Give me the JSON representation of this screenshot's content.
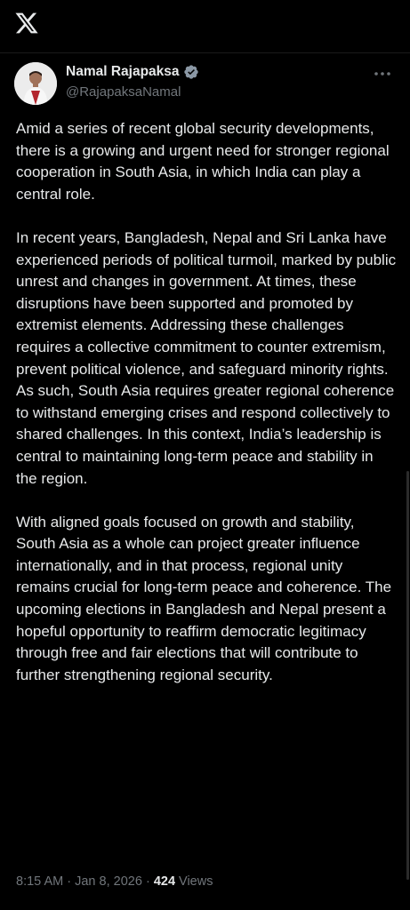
{
  "app": {
    "logo_icon": "x-logo-icon"
  },
  "author": {
    "display_name": "Namal Rajapaksa",
    "handle": "@RajapaksaNamal",
    "verified": true,
    "verified_badge_color": "#8b98a5",
    "more_icon": "more-horizontal-icon"
  },
  "tweet": {
    "paragraphs": [
      "Amid a series of recent global security developments, there is a growing and urgent need for stronger regional cooperation in South Asia, in which India can play a central role.",
      "In recent years, Bangladesh, Nepal and Sri Lanka have experienced periods of political turmoil, marked by public unrest and changes in government. At times, these disruptions have been supported and promoted by extremist elements. Addressing these challenges requires a collective commitment to counter extremism, prevent political violence, and safeguard minority rights. As such, South Asia requires greater regional coherence to withstand emerging crises and respond collectively to shared challenges. In this context, India’s leadership is central to maintaining long-term peace and stability in the region.",
      "With aligned goals focused on growth and stability, South Asia as a whole can project greater influence internationally, and in that process, regional unity remains crucial for long-term peace and coherence. The upcoming elections in Bangladesh and Nepal present a hopeful opportunity to reaffirm democratic legitimacy through free and fair elections that will contribute to further strengthening regional security."
    ],
    "time": "8:15 AM",
    "separator": "·",
    "date": "Jan 8, 2026",
    "views_count": "424",
    "views_label": "Views"
  },
  "colors": {
    "background": "#000000",
    "text_primary": "#e7e9ea",
    "text_secondary": "#71767b"
  }
}
